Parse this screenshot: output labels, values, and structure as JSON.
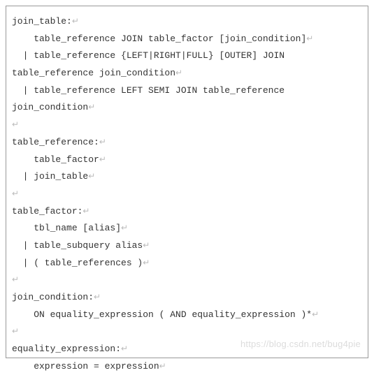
{
  "code": {
    "lines": [
      "join_table:",
      "    table_reference JOIN table_factor [join_condition]",
      "  | table_reference {LEFT|RIGHT|FULL} [OUTER] JOIN",
      "table_reference join_condition",
      "  | table_reference LEFT SEMI JOIN table_reference",
      "join_condition",
      "",
      "table_reference:",
      "    table_factor",
      "  | join_table",
      "",
      "table_factor:",
      "    tbl_name [alias]",
      "  | table_subquery alias",
      "  | ( table_references )",
      "",
      "join_condition:",
      "    ON equality_expression ( AND equality_expression )*",
      "",
      "equality_expression:",
      "    expression = expression"
    ],
    "line_end_marker": "↵"
  },
  "watermark": "https://blog.csdn.net/bug4pie"
}
